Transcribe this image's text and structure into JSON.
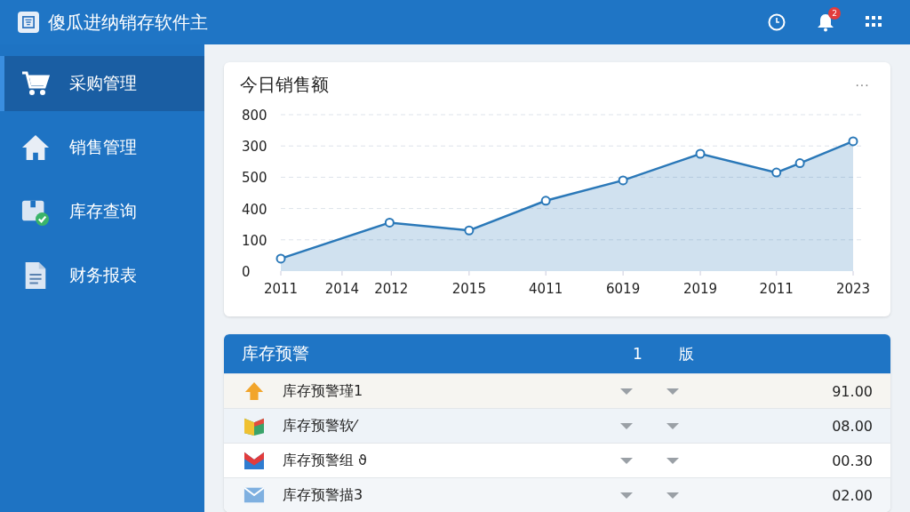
{
  "app": {
    "title": "傻瓜进纳销存软件主",
    "notifications": "2"
  },
  "sidebar": {
    "items": [
      {
        "label": "采购管理",
        "selected": true
      },
      {
        "label": "销售管理",
        "selected": false
      },
      {
        "label": "库存查询",
        "selected": false
      },
      {
        "label": "财务报表",
        "selected": false
      }
    ]
  },
  "sales_card": {
    "title": "今日销售额",
    "menu": "···",
    "y_axis_labels": [
      "800",
      "300",
      "500",
      "400",
      "100",
      "0"
    ],
    "x_axis_labels": [
      "2011",
      "2014",
      "2012",
      "2015",
      "4011",
      "6019",
      "2019",
      "2011",
      "2023"
    ]
  },
  "stock_alert": {
    "title": "库存预警",
    "column_2": "1",
    "column_3": "版",
    "rows": [
      {
        "name": "库存预警瑾1",
        "value": "91.00"
      },
      {
        "name": "库存预警软⁄",
        "value": "08.00"
      },
      {
        "name": "库存预警组 ϑ",
        "value": "00.30"
      },
      {
        "name": "库存预警描3",
        "value": "02.00"
      }
    ]
  }
}
